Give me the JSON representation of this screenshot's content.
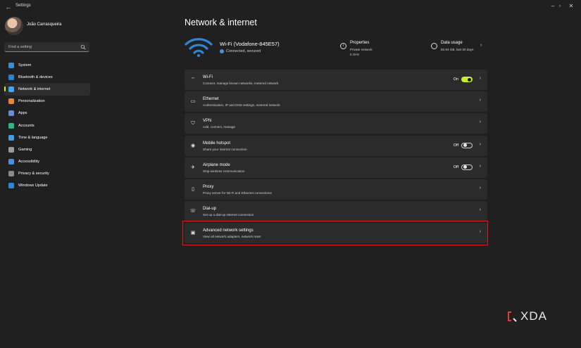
{
  "window": {
    "title": "Settings",
    "back_icon": "back-arrow-icon"
  },
  "profile": {
    "name": "João Carrasqueira"
  },
  "search": {
    "placeholder": "Find a setting"
  },
  "sidebar": {
    "items": [
      {
        "label": "System",
        "icon": "system-icon",
        "color": "#3a8fd6",
        "selected": false
      },
      {
        "label": "Bluetooth & devices",
        "icon": "bluetooth-icon",
        "color": "#2d7fd0",
        "selected": false
      },
      {
        "label": "Network & internet",
        "icon": "network-icon",
        "color": "#4aa3e8",
        "selected": true
      },
      {
        "label": "Personalization",
        "icon": "brush-icon",
        "color": "#e38b3b",
        "selected": false
      },
      {
        "label": "Apps",
        "icon": "apps-icon",
        "color": "#6b8ad8",
        "selected": false
      },
      {
        "label": "Accounts",
        "icon": "accounts-icon",
        "color": "#2fb57c",
        "selected": false
      },
      {
        "label": "Time & language",
        "icon": "clock-icon",
        "color": "#3f9fe0",
        "selected": false
      },
      {
        "label": "Gaming",
        "icon": "gaming-icon",
        "color": "#9a9a9a",
        "selected": false
      },
      {
        "label": "Accessibility",
        "icon": "accessibility-icon",
        "color": "#4a8fe0",
        "selected": false
      },
      {
        "label": "Privacy & security",
        "icon": "shield-icon",
        "color": "#8a8a8a",
        "selected": false
      },
      {
        "label": "Windows Update",
        "icon": "update-icon",
        "color": "#2f86d8",
        "selected": false
      }
    ]
  },
  "main": {
    "title": "Network & internet",
    "connection": {
      "name": "Wi-Fi (Vodafone-845E57)",
      "status": "Connected, secured"
    },
    "properties": {
      "title": "Properties",
      "line1": "Private network",
      "line2": "5 GHz"
    },
    "data_usage": {
      "title": "Data usage",
      "detail": "82.94 GB, last 30 days"
    },
    "rows": [
      {
        "title": "Wi-Fi",
        "subtitle": "Connect, manage known networks, metered network",
        "icon": "wifi-icon",
        "toggle": "on",
        "toggle_label": "On"
      },
      {
        "title": "Ethernet",
        "subtitle": "Authentication, IP and DNS settings, metered network",
        "icon": "ethernet-icon"
      },
      {
        "title": "VPN",
        "subtitle": "Add, connect, manage",
        "icon": "vpn-shield-icon"
      },
      {
        "title": "Mobile hotspot",
        "subtitle": "Share your internet connection",
        "icon": "hotspot-icon",
        "toggle": "off",
        "toggle_label": "Off"
      },
      {
        "title": "Airplane mode",
        "subtitle": "Stop wireless communication",
        "icon": "airplane-icon",
        "toggle": "off",
        "toggle_label": "Off"
      },
      {
        "title": "Proxy",
        "subtitle": "Proxy server for Wi-Fi and Ethernet connections",
        "icon": "proxy-icon"
      },
      {
        "title": "Dial-up",
        "subtitle": "Set up a dial-up internet connection",
        "icon": "dialup-icon"
      },
      {
        "title": "Advanced network settings",
        "subtitle": "View all network adapters, network reset",
        "icon": "advanced-network-icon"
      }
    ]
  },
  "colors": {
    "accent": "#c5f02f",
    "highlight_box": "#e01b1b",
    "wifi_hero": "#2f86d8"
  },
  "watermark": {
    "text": "XDA"
  }
}
